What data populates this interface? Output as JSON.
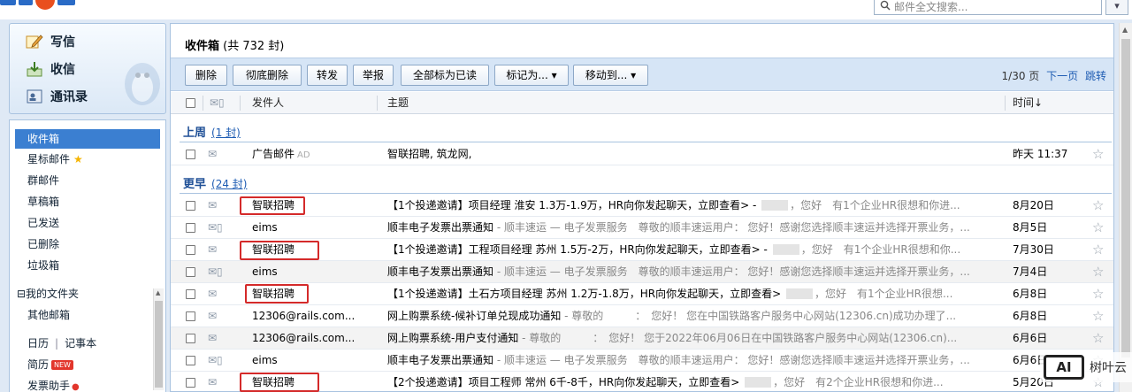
{
  "search": {
    "placeholder": "邮件全文搜索..."
  },
  "actions": [
    {
      "label": "写信",
      "icon": "compose-icon"
    },
    {
      "label": "收信",
      "icon": "inbox-download-icon"
    },
    {
      "label": "通讯录",
      "icon": "contacts-icon"
    }
  ],
  "folders": {
    "inbox": "收件箱",
    "starred": "星标邮件",
    "group": "群邮件",
    "drafts": "草稿箱",
    "sent": "已发送",
    "deleted": "已删除",
    "junk": "垃圾箱",
    "my_folders": "⊟我的文件夹",
    "other": "其他邮箱",
    "calendar": "日历",
    "notes": "记事本",
    "resume": "简历",
    "resume_badge": "NEW",
    "invoice": "发票助手"
  },
  "main": {
    "title": "收件箱",
    "count": "(共 732 封)"
  },
  "toolbar": {
    "delete": "删除",
    "delete_forever": "彻底删除",
    "forward": "转发",
    "report": "举报",
    "mark_all_read": "全部标为已读",
    "mark_as": "标记为... ▾",
    "move_to": "移动到... ▾",
    "page": "1/30 页",
    "next": "下一页",
    "jump": "跳转"
  },
  "columns": {
    "from": "发件人",
    "subject": "主题",
    "time": "时间↓"
  },
  "groups": {
    "last_week": {
      "label": "上周",
      "count": "(1 封)"
    },
    "earlier": {
      "label": "更早",
      "count": "(24 封)"
    }
  },
  "rows": [
    {
      "from": "广告邮件",
      "tag": "AD",
      "subject": "智联招聘, 筑龙网,",
      "preview": "",
      "time": "昨天 11:37"
    },
    {
      "from": "智联招聘",
      "tag": "",
      "subject": "【1个投递邀请】项目经理 淮安 1.3万-1.9万，HR向你发起聊天，立即查看> - ",
      "preview": "，您好　有1个企业HR很想和你进...",
      "time": "8月20日"
    },
    {
      "from": "eims",
      "tag": "",
      "subject": "顺丰电子发票出票通知",
      "preview": " - 顺丰速运 — 电子发票服务　尊敬的顺丰速运用户： 您好！感谢您选择顺丰速运并选择开票业务，...",
      "time": "8月5日"
    },
    {
      "from": "智联招聘",
      "tag": "",
      "subject": "【1个投递邀请】工程项目经理 苏州 1.5万-2万，HR向你发起聊天，立即查看> - ",
      "preview": "，您好　有1个企业HR很想和你...",
      "time": "7月30日"
    },
    {
      "from": "eims",
      "tag": "",
      "subject": "顺丰电子发票出票通知",
      "preview": " - 顺丰速运 — 电子发票服务　尊敬的顺丰速运用户： 您好！感谢您选择顺丰速运并选择开票业务，...",
      "time": "7月4日"
    },
    {
      "from": "智联招聘",
      "tag": "",
      "subject": "【1个投递邀请】土石方项目经理 苏州 1.2万-1.8万，HR向你发起聊天，立即查看> ",
      "preview": "，您好　有1个企业HR很想...",
      "time": "6月8日"
    },
    {
      "from": "12306@rails.com...",
      "tag": "",
      "subject": "网上购票系统-候补订单兑现成功通知",
      "preview": " - 尊敬的　　　：　您好！ 您在中国铁路客户服务中心网站(12306.cn)成功办理了...",
      "time": "6月8日"
    },
    {
      "from": "12306@rails.com...",
      "tag": "",
      "subject": "网上购票系统-用户支付通知",
      "preview": " - 尊敬的　　　：　您好！ 您于2022年06月06日在中国铁路客户服务中心网站(12306.cn)...",
      "time": "6月6日"
    },
    {
      "from": "eims",
      "tag": "",
      "subject": "顺丰电子发票出票通知",
      "preview": " - 顺丰速运 — 电子发票服务　尊敬的顺丰速运用户： 您好！感谢您选择顺丰速运并选择开票业务，...",
      "time": "6月6日"
    },
    {
      "from": "智联招聘",
      "tag": "",
      "subject": "【2个投递邀请】项目工程师 常州 6千-8千，HR向你发起聊天，立即查看> ",
      "preview": "，您好　有2个企业HR很想和你进...",
      "time": "5月20日"
    }
  ],
  "watermark": {
    "box": "AI",
    "text": "树叶云"
  }
}
